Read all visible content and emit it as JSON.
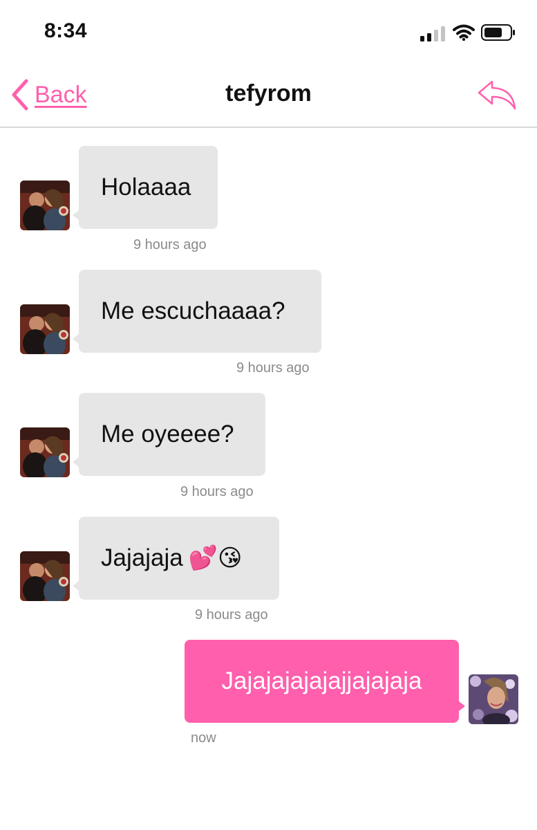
{
  "status_bar": {
    "time": "8:34",
    "icons": [
      "signal-icon",
      "wifi-icon",
      "battery-icon"
    ]
  },
  "nav": {
    "back_label": "Back",
    "title": "tefyrom",
    "reply_icon": "reply-icon"
  },
  "colors": {
    "accent": "#ff5fac",
    "incoming_bubble": "#e6e6e6",
    "timestamp": "#8a8a8a"
  },
  "messages": [
    {
      "direction": "incoming",
      "text": "Holaaaa",
      "time": "9 hours ago"
    },
    {
      "direction": "incoming",
      "text": "Me escuchaaaa?",
      "time": "9 hours ago"
    },
    {
      "direction": "incoming",
      "text": "Me oyeeee?",
      "time": "9 hours ago"
    },
    {
      "direction": "incoming",
      "text": "Jajajaja",
      "emoji": "💕😘",
      "time": "9 hours ago"
    },
    {
      "direction": "outgoing",
      "text": "Jajajajajajajjajajaja",
      "time": "now"
    }
  ]
}
